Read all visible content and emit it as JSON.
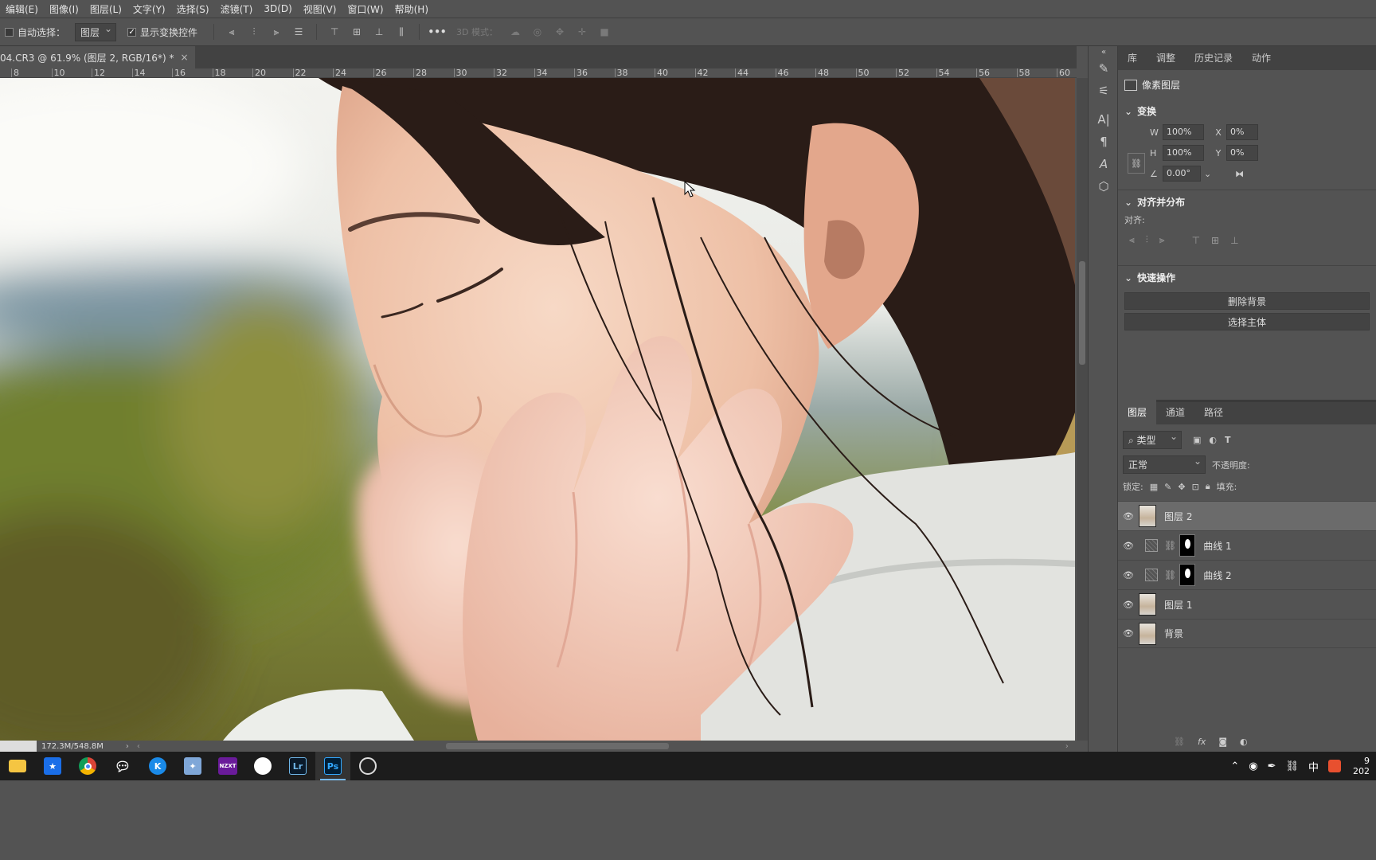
{
  "menubar": [
    "编辑(E)",
    "图像(I)",
    "图层(L)",
    "文字(Y)",
    "选择(S)",
    "滤镜(T)",
    "3D(D)",
    "视图(V)",
    "窗口(W)",
    "帮助(H)"
  ],
  "options": {
    "auto_select_label": "自动选择：",
    "auto_select_target": "图层",
    "show_transform_label": "显示变换控件",
    "mode_3d_label": "3D 模式：",
    "more": "•••"
  },
  "document": {
    "tab_title": "04.CR3 @ 61.9% (图层 2, RGB/16*) *",
    "close": "×"
  },
  "ruler": {
    "ticks": [
      "8",
      "10",
      "12",
      "14",
      "16",
      "18",
      "20",
      "22",
      "24",
      "26",
      "28",
      "30",
      "32",
      "34",
      "36",
      "38",
      "40",
      "42",
      "44",
      "46",
      "48",
      "50",
      "52",
      "54",
      "56",
      "58",
      "60"
    ]
  },
  "status": {
    "doc_size": "172.3M/548.8M"
  },
  "properties": {
    "tabs": [
      "库",
      "调整",
      "历史记录",
      "动作"
    ],
    "pixel_layer_label": "像素图层",
    "transform_title": "变换",
    "w_label": "W",
    "w_value": "100%",
    "h_label": "H",
    "h_value": "100%",
    "x_label": "X",
    "x_value": "0%",
    "y_label": "Y",
    "y_value": "0%",
    "angle_value": "0.00°",
    "align_title": "对齐并分布",
    "align_label": "对齐:",
    "quick_title": "快速操作",
    "remove_bg": "删除背景",
    "select_subject": "选择主体"
  },
  "layers_panel": {
    "tabs": [
      "图层",
      "通道",
      "路径"
    ],
    "filter_kind": "类型",
    "blend_mode": "正常",
    "opacity_label": "不透明度:",
    "lock_label": "锁定:",
    "fill_label": "填充:",
    "layers": [
      {
        "name": "图层 2",
        "kind": "pixel",
        "selected": true
      },
      {
        "name": "曲线 1",
        "kind": "curves"
      },
      {
        "name": "曲线 2",
        "kind": "curves"
      },
      {
        "name": "图层 1",
        "kind": "pixel"
      },
      {
        "name": "背景",
        "kind": "pixel"
      }
    ]
  },
  "taskbar": {
    "apps": [
      "file-explorer",
      "pin-app",
      "chrome",
      "wechat",
      "k-app",
      "feather-app",
      "nzxt",
      "circle-app",
      "lightroom",
      "photoshop",
      "obs"
    ],
    "nzxt_label": "NZXT",
    "lr_label": "Lr",
    "ps_label": "Ps",
    "ime_char": "中",
    "clock_line1": "9",
    "clock_line2": "202"
  },
  "ime_badge": {
    "s": "S",
    "zh": "中"
  }
}
